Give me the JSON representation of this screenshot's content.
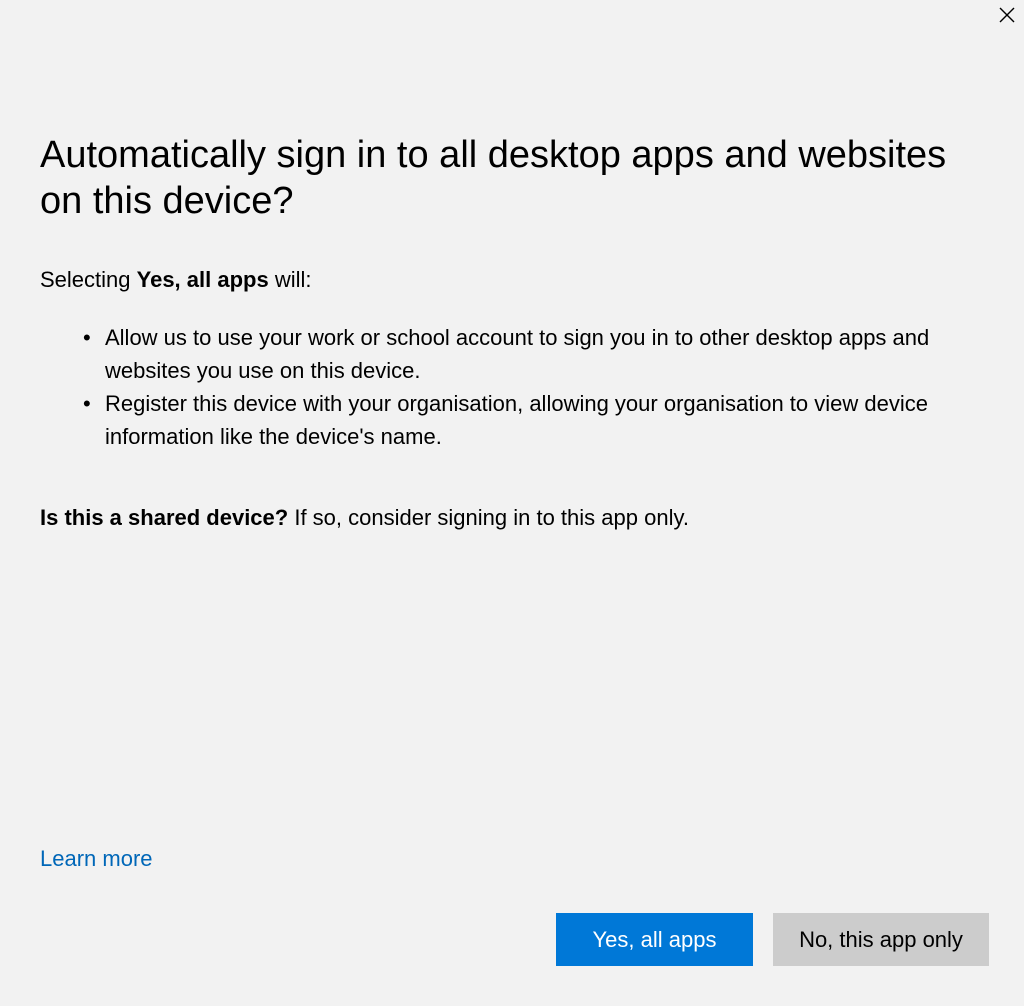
{
  "dialog": {
    "title": "Automatically sign in to all desktop apps and websites on this device?",
    "intro": {
      "prefix": "Selecting ",
      "bold": "Yes, all apps",
      "suffix": " will:"
    },
    "bullets": [
      "Allow us to use your work or school account to sign you in to other desktop apps and websites you use on this device.",
      "Register this device with your organisation, allowing your organisation to view device information like the device's name."
    ],
    "bullet_glyph": "•",
    "shared": {
      "bold": "Is this a shared device?",
      "text": " If so, consider signing in to this app only."
    },
    "learn_more": "Learn more",
    "buttons": {
      "primary": "Yes, all apps",
      "secondary": "No, this app only"
    }
  },
  "icons": {
    "close": "close-icon"
  },
  "colors": {
    "background": "#f2f2f2",
    "primary_button": "#0078d7",
    "secondary_button": "#cccccc",
    "link": "#0067b8"
  }
}
